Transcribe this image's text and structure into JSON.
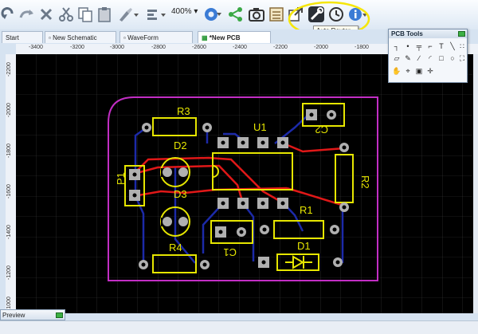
{
  "toolbar": {
    "zoom_level": "400%",
    "tooltip": "Auto Router...",
    "icons": [
      "redo-icon",
      "undo-icon",
      "delete-icon",
      "cut-icon",
      "copy-icon",
      "paste-icon",
      "brush-icon",
      "align-icon",
      "zoom-dropdown-icon",
      "settings-gear-icon",
      "share-icon",
      "camera-icon",
      "bom-icon",
      "export-icon",
      "auto-router-icon",
      "history-icon",
      "info-icon"
    ]
  },
  "tabs": [
    {
      "label": "Start"
    },
    {
      "label": "New Schematic"
    },
    {
      "label": "WaveForm"
    },
    {
      "label": "*New PCB"
    }
  ],
  "ruler": {
    "h_ticks": [
      "-3400",
      "-3200",
      "-3000",
      "-2800",
      "-2600",
      "-2400",
      "-2200",
      "-2000",
      "-1800"
    ],
    "v_ticks": [
      "-2200",
      "-2000",
      "-1800",
      "-1600",
      "-1400",
      "-1200",
      "-1000"
    ]
  },
  "pcb_tools": {
    "title": "PCB Tools"
  },
  "preview": {
    "title": "Preview"
  },
  "board": {
    "labels": {
      "r3": "R3",
      "u1": "U1",
      "c2": "C2",
      "d2": "D2",
      "p1": "P1",
      "r2": "R2",
      "d3": "D3",
      "r1": "R1",
      "r4": "R4",
      "c1": "C1",
      "d1": "D1"
    },
    "colors": {
      "outline": "#c22ec4",
      "silk": "#e6e600",
      "top_trace": "#e01818",
      "bottom_trace": "#1c2aa8",
      "pad": "#b0b0b0",
      "grid": "#3a3a3a"
    }
  },
  "highlight_color": "#f5e60a"
}
